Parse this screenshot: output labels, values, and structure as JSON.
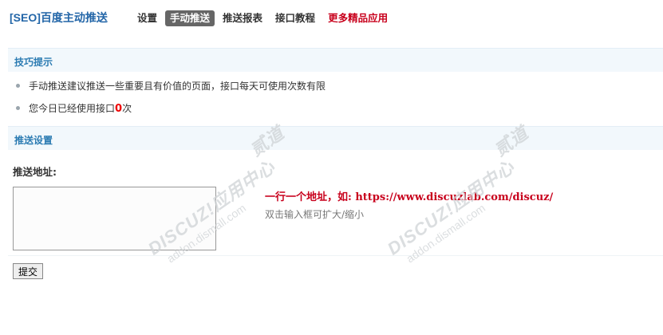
{
  "header": {
    "title": "[SEO]百度主动推送",
    "nav": [
      {
        "label": "设置",
        "state": "normal"
      },
      {
        "label": "手动推送",
        "state": "active"
      },
      {
        "label": "推送报表",
        "state": "normal"
      },
      {
        "label": "接口教程",
        "state": "normal"
      },
      {
        "label": "更多精品应用",
        "state": "highlight"
      }
    ]
  },
  "tips": {
    "title": "技巧提示",
    "items": [
      "手动推送建议推送一些重要且有价值的页面，接口每天可使用次数有限"
    ],
    "usage_prefix": "您今日已经使用接口",
    "usage_count": "0",
    "usage_suffix": "次"
  },
  "push": {
    "title": "推送设置",
    "field_label": "推送地址:",
    "urls_value": "",
    "hint_main": "一行一个地址，如: https://www.discuzlab.com/discuz/",
    "hint_sub": "双击输入框可扩大/缩小",
    "submit_label": "提交"
  },
  "colors": {
    "accent": "#2366a8",
    "section_title": "#2b7bb2",
    "highlight": "#c8001c",
    "count": "#e00000"
  },
  "watermark": {
    "brand": "DISCUZ!应用中心",
    "url": "addon.dismall.com",
    "mark": "贰道"
  }
}
